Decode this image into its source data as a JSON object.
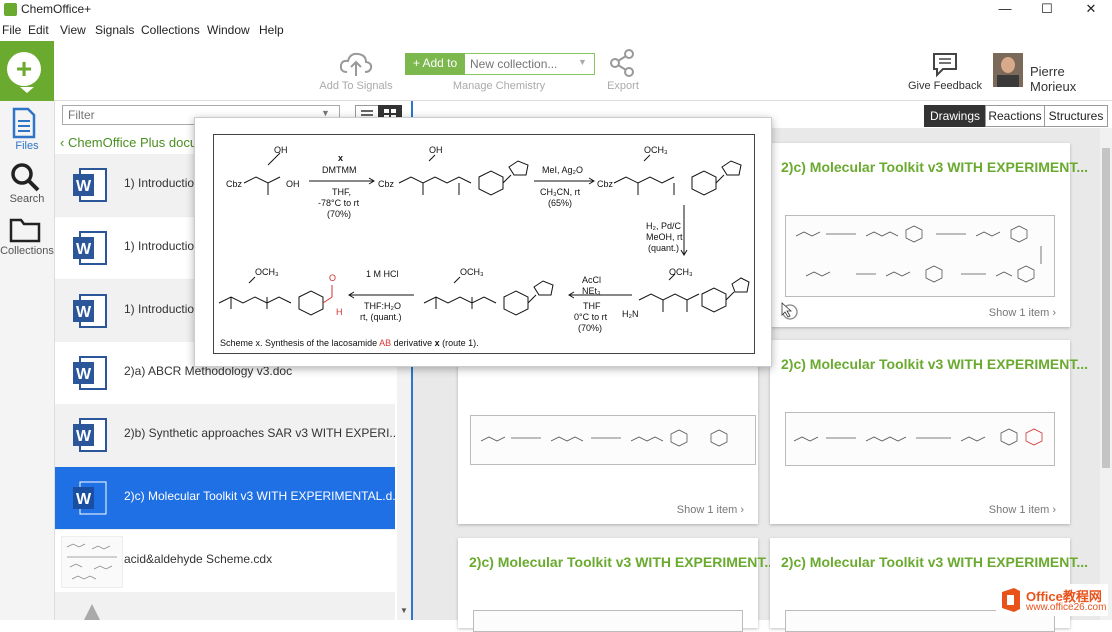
{
  "app": {
    "title": "ChemOffice+",
    "window_controls": [
      "—",
      "☐",
      "✕"
    ]
  },
  "menu": [
    "File",
    "Edit",
    "View",
    "Signals",
    "Collections",
    "Window",
    "Help"
  ],
  "toolbar": {
    "add_to_signals": "Add To Signals",
    "add_to_label": "+ Add to",
    "collection_placeholder": "New collection...",
    "manage_chemistry": "Manage Chemistry",
    "export": "Export",
    "give_feedback": "Give Feedback",
    "user_name": "Pierre Morieux"
  },
  "leftnav": [
    {
      "label": "Files",
      "icon": "files-icon"
    },
    {
      "label": "Search",
      "icon": "search-icon"
    },
    {
      "label": "Collections",
      "icon": "folder-icon"
    }
  ],
  "filter": {
    "placeholder": "Filter"
  },
  "breadcrumb": "ChemOffice Plus docu",
  "files": [
    {
      "label": "1) Introductio",
      "type": "word"
    },
    {
      "label": "1) Introductio",
      "type": "word"
    },
    {
      "label": "1) Introductio",
      "type": "word"
    },
    {
      "label": "2)a) ABCR Methodology v3.doc",
      "type": "word"
    },
    {
      "label": "2)b) Synthetic approaches SAR v3 WITH EXPERI...",
      "type": "word"
    },
    {
      "label": "2)c) Molecular Toolkit v3 WITH EXPERIMENTAL.d...",
      "type": "word",
      "selected": true
    },
    {
      "label": "acid&aldehyde Scheme.cdx",
      "type": "cdx"
    }
  ],
  "view_tabs": [
    "Drawings",
    "Reactions",
    "Structures"
  ],
  "active_tab": "Drawings",
  "cards": [
    {
      "title": "2)c) Molecular Toolkit v3 WITH EXPERIMENT...",
      "show": "Show 1 item ›"
    },
    {
      "title": "2)c) Molecular Toolkit v3 WITH EXPERIMENT...",
      "show": "Show 1 item ›"
    },
    {
      "title": "",
      "show": "Show 1 item ›"
    },
    {
      "title": "2)c) Molecular Toolkit v3 WITH EXPERIMENT...",
      "show": "Show 1 item ›"
    },
    {
      "title": "2)c) Molecular Toolkit v3 WITH EXPERIMENT...",
      "show": ""
    }
  ],
  "popup": {
    "caption_prefix": "Scheme x. Synthesis of the lacosamide ",
    "caption_highlight": "AB",
    "caption_mid": " derivative ",
    "caption_bold": "x",
    "caption_suffix": " (route 1).",
    "step1": [
      "x",
      "DMTMM",
      "THF,",
      "-78°C to rt",
      "(70%)"
    ],
    "step2": [
      "MeI, Ag₂O",
      "CH₃CN, rt",
      "(65%)"
    ],
    "step3": [
      "H₂, Pd/C",
      "MeOH, rt",
      "(quant.)"
    ],
    "step4": [
      "AcCl",
      "NEt₃",
      "THF",
      "0°C to rt",
      "(70%)"
    ],
    "step5": [
      "1 M HCl",
      "THF:H₂O",
      "rt, (quant.)"
    ],
    "labels": {
      "cbz": "Cbz",
      "oh": "OH",
      "och3": "OCH₃",
      "h2n": "H₂N",
      "n": "N",
      "h": "H",
      "o": "O"
    }
  },
  "colors": {
    "brand_green": "#6aaa2f",
    "selection_blue": "#1f6fe5",
    "word_blue": "#2b579a"
  },
  "watermark": {
    "line1": "Office教程网",
    "line2": "www.office26.com"
  }
}
